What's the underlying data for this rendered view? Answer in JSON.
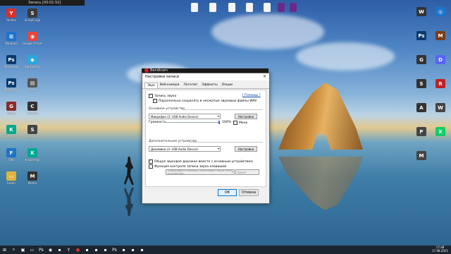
{
  "mini_window": {
    "title": "Запись [00:01:52]"
  },
  "bandicam_title": "Bandicam",
  "dialog": {
    "title": "Настройки записи",
    "tabs": [
      "Звук",
      "Веб-камера",
      "Логотип",
      "Эффекты",
      "Опции"
    ],
    "record_sound": "Запись звука",
    "help_link": "[ Помощь ]",
    "save_parallel": "Параллельно сохранять в несжатые звуковые файлы WAV",
    "primary_section": "Основное устройство",
    "primary_device": "Микрофон (3- USB Audio Device)",
    "settings_btn": "Настройки",
    "volume_label": "Громкость",
    "volume_value": "100%",
    "mono_label": "Моно",
    "secondary_section": "Дополнительное устройство",
    "secondary_device": "Динамики (3- USB Audio Device)",
    "settings_btn2": "Настройки",
    "mix_track": "Общая звуковая дорожка вместе с основным устройством",
    "hotkey_func": "Функция контроля записи звука клавишей",
    "hotkey_placeholder": "Удерживайте клавишу (записывает звуки этого устройства)",
    "hotkey_key": "Space",
    "ok": "ОК",
    "cancel": "Отмена"
  },
  "desktop_icons_left": [
    {
      "label": "Yandex",
      "icon": "yandex-icon",
      "color": "#d8312b",
      "glyph": "Y"
    },
    {
      "label": "ScrapForge",
      "icon": "app-icon",
      "color": "#3a3a3a",
      "glyph": "S"
    },
    {
      "label": "Windows",
      "icon": "windows-icon",
      "color": "#1e74c9",
      "glyph": "⊞"
    },
    {
      "label": "Google Chrome",
      "icon": "chrome-icon",
      "color": "#e8453c",
      "glyph": "◉"
    },
    {
      "label": "Photoshop",
      "icon": "photoshop-icon",
      "color": "#0a3a6e",
      "glyph": "Ps"
    },
    {
      "label": "AppGallery",
      "icon": "appgallery-icon",
      "color": "#2aa9e0",
      "glyph": "◆"
    },
    {
      "label": "Photoshop",
      "icon": "photoshop-icon",
      "color": "#0a3a6e",
      "glyph": "Ps"
    },
    {
      "label": "Printer",
      "icon": "printer-icon",
      "color": "#555",
      "glyph": "▤"
    },
    {
      "label": "Game",
      "icon": "game-icon",
      "color": "#8a2b2b",
      "glyph": "G"
    },
    {
      "label": "Cinema",
      "icon": "cinema-icon",
      "color": "#333",
      "glyph": "C"
    },
    {
      "label": "Kaspersky",
      "icon": "kaspersky-icon",
      "color": "#00a88e",
      "glyph": "K"
    },
    {
      "label": "SecureX",
      "icon": "secure-icon",
      "color": "#444",
      "glyph": "S"
    },
    {
      "label": "Files",
      "icon": "files-icon",
      "color": "#1e74c9",
      "glyph": "F"
    },
    {
      "label": "Kaspersky",
      "icon": "kaspersky-icon",
      "color": "#00a88e",
      "glyph": "K"
    },
    {
      "label": "Folder",
      "icon": "folder-icon",
      "color": "#e2b33b",
      "glyph": "▭"
    },
    {
      "label": "Media",
      "icon": "media-icon",
      "color": "#333",
      "glyph": "M"
    }
  ],
  "desktop_icons_top": [
    "file-icon",
    "file-icon",
    "file-icon",
    "file-icon",
    "file-icon",
    "app-icon",
    "app-icon"
  ],
  "desktop_icons_right": [
    {
      "icon": "game-icon",
      "color": "#333",
      "glyph": "W"
    },
    {
      "icon": "logo-icon",
      "color": "#1e74c9",
      "glyph": "◎"
    },
    {
      "icon": "ps-icon",
      "color": "#0a3a6e",
      "glyph": "Ps"
    },
    {
      "icon": "game-icon",
      "color": "#7b3d1a",
      "glyph": "M"
    },
    {
      "icon": "app-icon",
      "color": "#333",
      "glyph": "G"
    },
    {
      "icon": "discord-icon",
      "color": "#5865f2",
      "glyph": "D"
    },
    {
      "icon": "app-icon",
      "color": "#333",
      "glyph": "S"
    },
    {
      "icon": "app-icon",
      "color": "#b22",
      "glyph": "R"
    },
    {
      "icon": "app-icon",
      "color": "#333",
      "glyph": "A"
    },
    {
      "icon": "app-icon",
      "color": "#444",
      "glyph": "W"
    },
    {
      "icon": "app-icon",
      "color": "#444",
      "glyph": "P"
    },
    {
      "icon": "app-icon",
      "color": "#1c6",
      "glyph": "X"
    },
    {
      "icon": "app-icon",
      "color": "#444",
      "glyph": "M"
    }
  ],
  "taskbar": {
    "items": [
      "start-icon",
      "search-icon",
      "task-view-icon",
      "explorer-icon",
      "photoshop-icon",
      "chrome-icon",
      "app-icon",
      "yandex-icon",
      "bandicam-icon",
      "app-icon",
      "app-icon",
      "app-icon",
      "photoshop-icon",
      "app-icon",
      "app-icon",
      "app-icon"
    ],
    "clock_time": "17:48",
    "clock_date": "17.08.2021"
  }
}
